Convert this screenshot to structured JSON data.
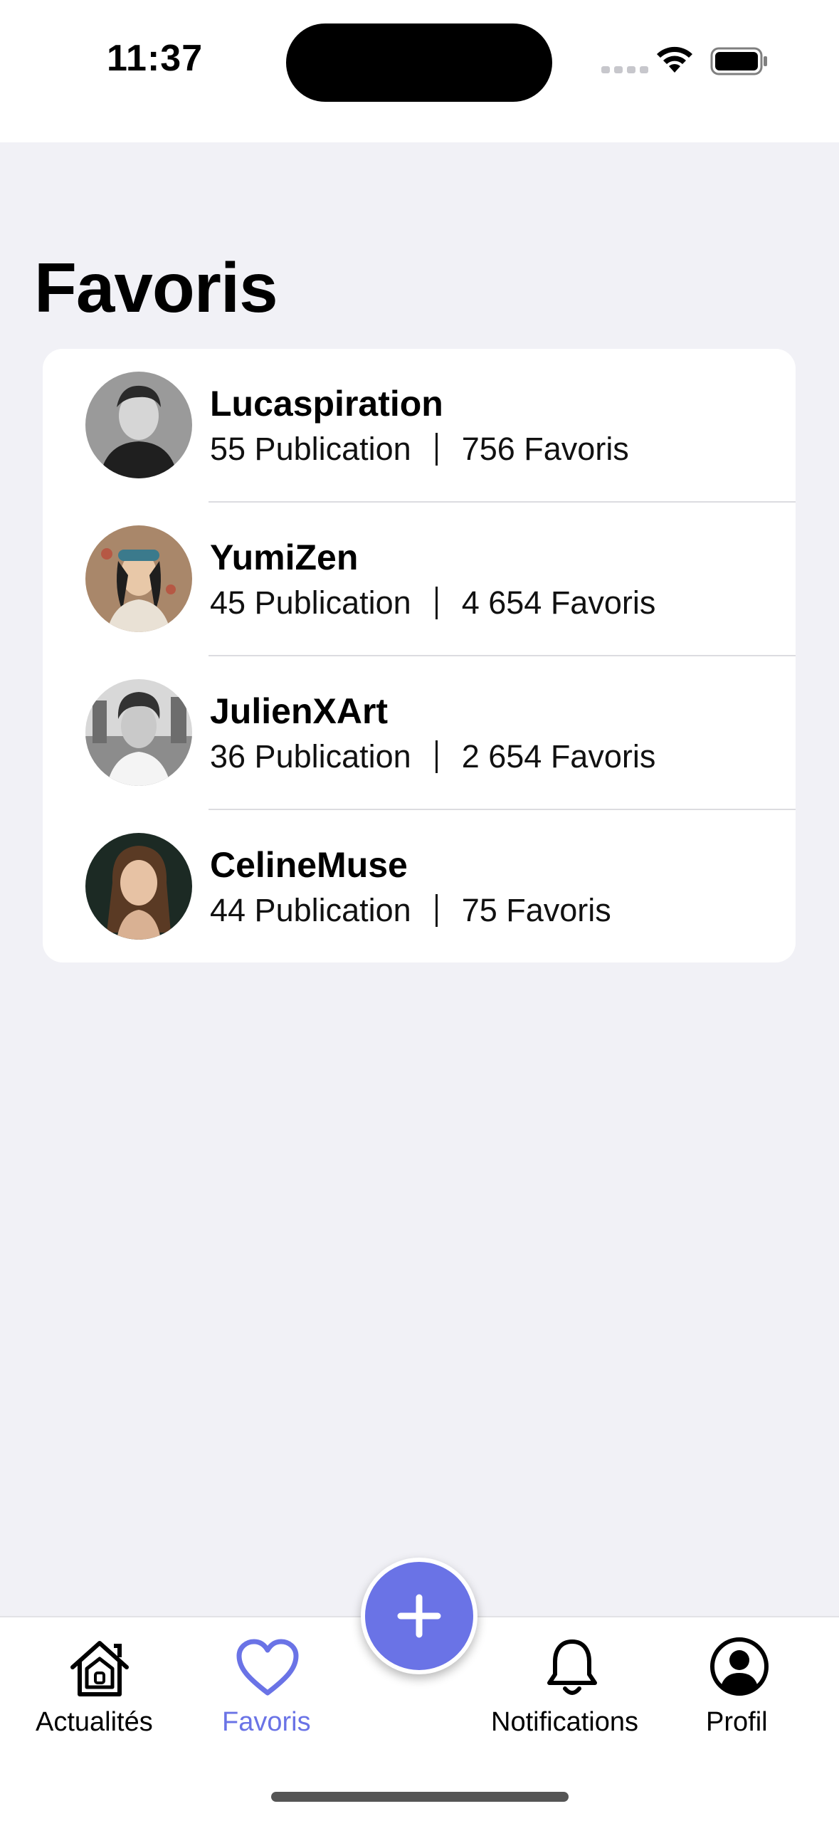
{
  "status_bar": {
    "time": "11:37"
  },
  "page": {
    "title": "Favoris"
  },
  "favorites": [
    {
      "username": "Lucaspiration",
      "publications": "55 Publication",
      "favoris": "756 Favoris"
    },
    {
      "username": "YumiZen",
      "publications": "45 Publication",
      "favoris": "4 654 Favoris"
    },
    {
      "username": "JulienXArt",
      "publications": "36 Publication",
      "favoris": "2 654 Favoris"
    },
    {
      "username": "CelineMuse",
      "publications": "44 Publication",
      "favoris": "75 Favoris"
    }
  ],
  "tab_bar": {
    "active_color": "#6a73e6",
    "tabs": [
      {
        "label": "Actualités",
        "icon": "home-icon"
      },
      {
        "label": "Favoris",
        "icon": "heart-icon",
        "active": true
      },
      {
        "label": "Notifications",
        "icon": "bell-icon"
      },
      {
        "label": "Profil",
        "icon": "profile-icon"
      }
    ],
    "fab_icon": "plus-icon"
  }
}
